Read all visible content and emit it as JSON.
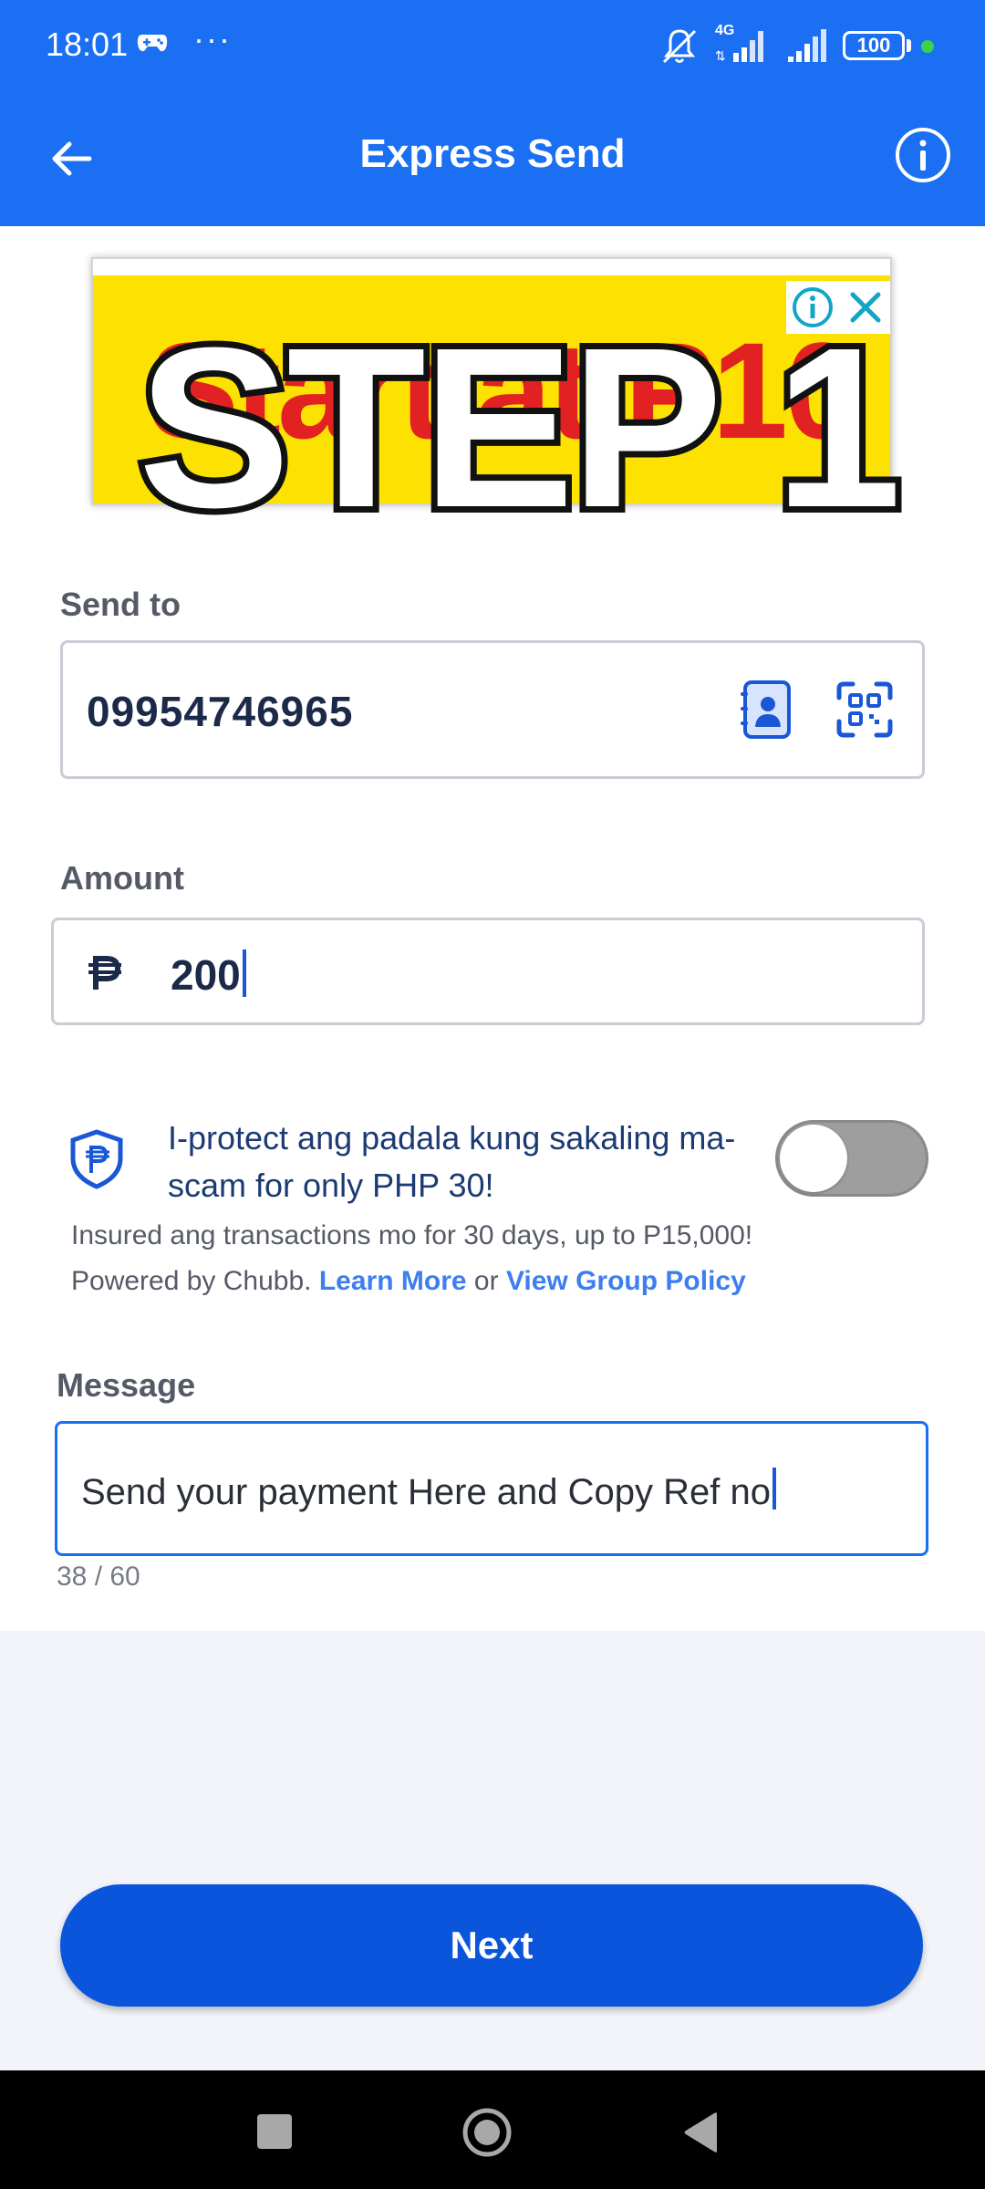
{
  "status_bar": {
    "time": "18:01",
    "dots": "···",
    "network": "4G",
    "battery": "100"
  },
  "app_bar": {
    "title": "Express Send"
  },
  "ad": {
    "text": "Start at P10",
    "overlay": "STEP 1"
  },
  "send_to": {
    "label": "Send to",
    "value": "09954746965"
  },
  "amount": {
    "label": "Amount",
    "value": "200"
  },
  "protect": {
    "text": "I-protect ang padala kung sakaling ma-scam for only PHP 30!",
    "toggle_on": false,
    "insured_text": "Insured ang transactions mo for 30 days, up to P15,000!",
    "powered_text": "Powered by Chubb.",
    "learn_more": "Learn More",
    "or": "or",
    "group_policy": "View Group Policy"
  },
  "message": {
    "label": "Message",
    "value": "Send your payment Here and Copy Ref no",
    "counter": "38 / 60"
  },
  "next_button": "Next",
  "colors": {
    "primary": "#1b6ff3",
    "button": "#0a55dc",
    "ad_bg": "#fde100"
  }
}
